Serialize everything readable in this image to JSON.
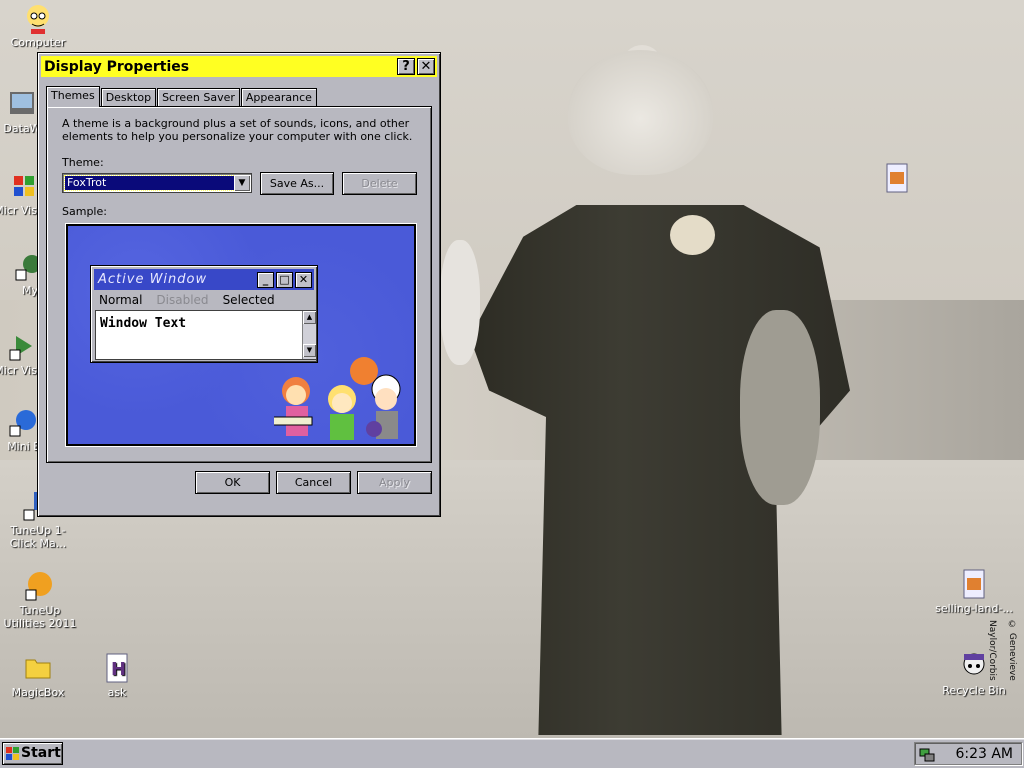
{
  "desktop": {
    "icons": [
      {
        "label": "Computer"
      },
      {
        "label": "DataW"
      },
      {
        "label": "Micr Visual"
      },
      {
        "label": "My"
      },
      {
        "label": "Micr Visual"
      },
      {
        "label": "Mini B"
      },
      {
        "label": "TuneUp 1-Click Ma..."
      },
      {
        "label": "TuneUp Utilities 2011"
      },
      {
        "label": "MagicBox"
      },
      {
        "label": "ask"
      },
      {
        "label": "selling-land-..."
      },
      {
        "label": "Recycle Bin"
      }
    ],
    "credit": "© Genevieve Naylor/Corbis"
  },
  "dialog": {
    "title": "Display Properties",
    "help_button": "?",
    "close_button": "✕",
    "tabs": [
      "Themes",
      "Desktop",
      "Screen Saver",
      "Appearance"
    ],
    "description": "A theme is a background plus a set of sounds, icons, and other elements to help you personalize your computer with one click.",
    "theme_label": "Theme:",
    "theme_value": "FoxTrot",
    "save_as": "Save As...",
    "delete": "Delete",
    "sample_label": "Sample:",
    "sample": {
      "window_title": "Active Window",
      "menu": [
        "Normal",
        "Disabled",
        "Selected"
      ],
      "window_text": "Window Text"
    },
    "ok": "OK",
    "cancel": "Cancel",
    "apply": "Apply"
  },
  "taskbar": {
    "start_label": "Start",
    "clock": "6:23 AM"
  },
  "colors": {
    "title_bar": "#ffff22",
    "sample_bg": "#4a5ad8",
    "selection": "#0a0a7a"
  }
}
